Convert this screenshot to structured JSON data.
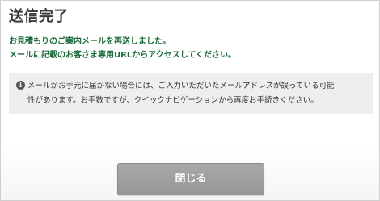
{
  "dialog": {
    "title": "送信完了",
    "message_lines": [
      "お見積もりのご案内メールを再送しました。",
      "メールに記載のお客さま専用URLからアクセスしてください。"
    ],
    "notice": {
      "icon": "info-icon",
      "icon_glyph": "i",
      "lines": [
        "メールがお手元に届かない場合には、ご入力いただいたメールアドレスが誤っている可能",
        "性があります。お手数ですが、クイックナビゲーションから再度お手続きください。"
      ]
    },
    "close_label": "閉じる"
  },
  "colors": {
    "message_text": "#1b6b3a",
    "notice_background": "#eeeeee",
    "button_background": "#9e9e9e",
    "title_text": "#3a3a3a"
  }
}
